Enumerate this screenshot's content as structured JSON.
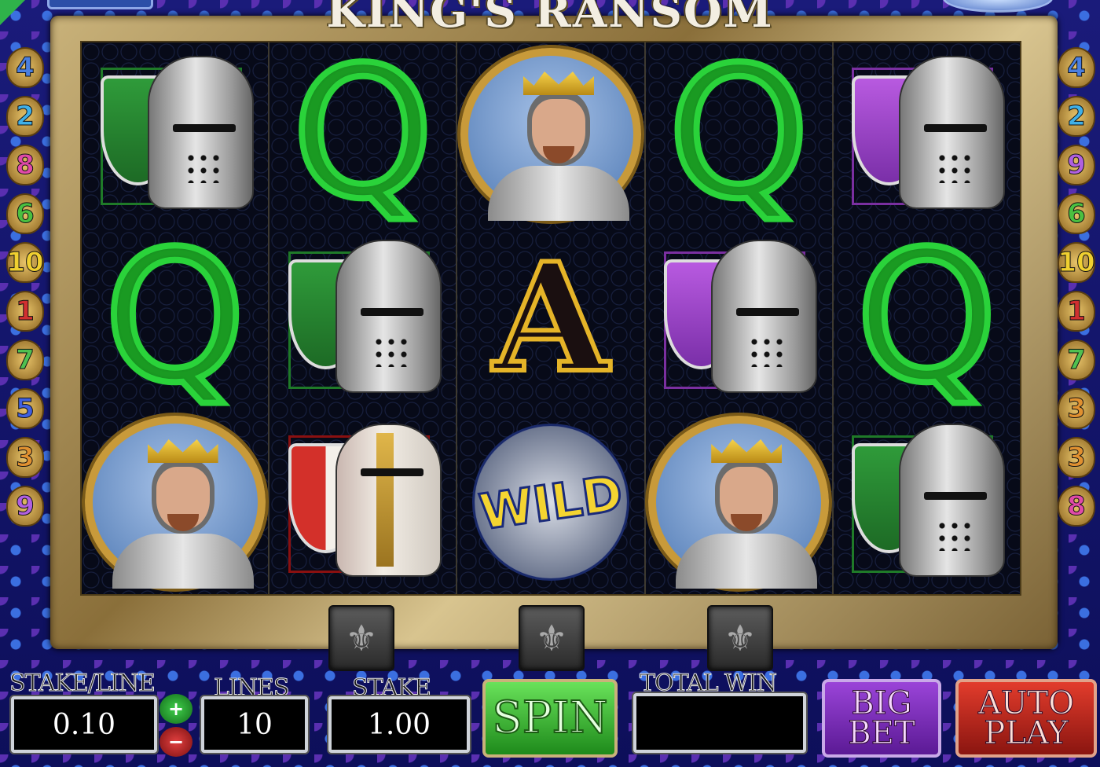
{
  "title": "KING'S RANSOM",
  "paylines_left": [
    "4",
    "2",
    "8",
    "6",
    "10",
    "1",
    "7",
    "5",
    "3",
    "9"
  ],
  "paylines_right": [
    "4",
    "2",
    "9",
    "6",
    "10",
    "1",
    "7",
    "3",
    "3",
    "8"
  ],
  "payline_colors": {
    "4": "#4a7fe0",
    "2": "#3fb0e8",
    "8": "#e04aa8",
    "9": "#b060e0",
    "6": "#4ac040",
    "10": "#f0d030",
    "1": "#d03030",
    "7": "#50c050",
    "5": "#4060e0",
    "3": "#e09030"
  },
  "reels": [
    [
      "green-shield-helmet",
      "queen",
      "king"
    ],
    [
      "queen",
      "green-shield-helmet",
      "red-shield-gold-helmet"
    ],
    [
      "king",
      "ace",
      "wild"
    ],
    [
      "queen",
      "purple-shield-helmet",
      "king"
    ],
    [
      "purple-shield-helmet",
      "queen",
      "green-shield-helmet"
    ]
  ],
  "symbols": {
    "queen": "Q",
    "ace": "A",
    "wild": "WILD"
  },
  "controls": {
    "stake_line_label": "STAKE/LINE",
    "stake_line_value": "0.10",
    "lines_label": "LINES",
    "lines_value": "10",
    "stake_label": "STAKE",
    "stake_value": "1.00",
    "spin_label": "SPIN",
    "total_win_label": "TOTAL WIN",
    "total_win_value": "",
    "big_bet_label_1": "BIG",
    "big_bet_label_2": "BET",
    "auto_play_label_1": "AUTO",
    "auto_play_label_2": "PLAY",
    "plus": "+",
    "minus": "−"
  },
  "colors": {
    "spin": "#2ea82a",
    "big_bet": "#7a2fb8",
    "auto_play": "#c42a1e",
    "frame_gold": "#c9b27a"
  }
}
